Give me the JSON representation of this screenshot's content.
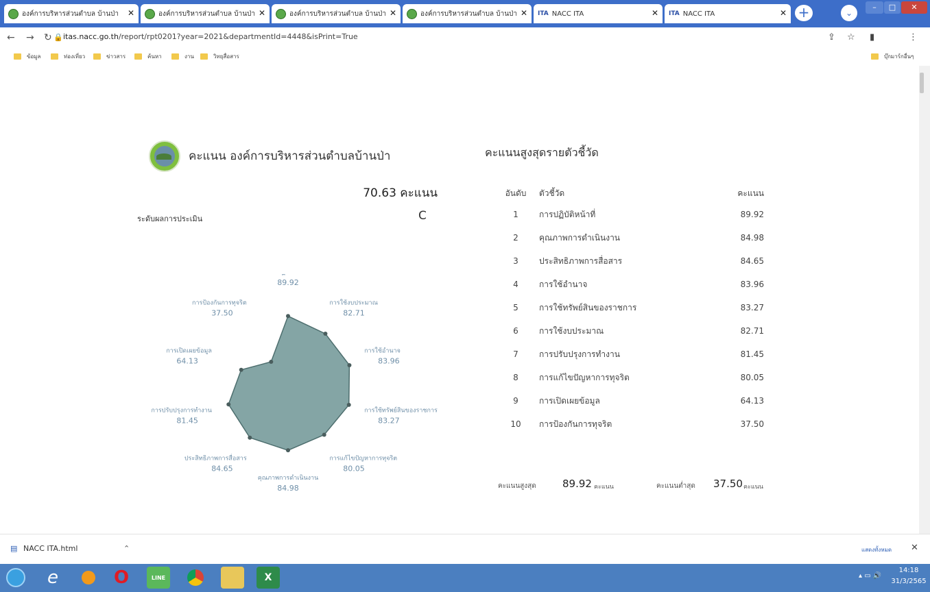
{
  "browser": {
    "tabs": [
      {
        "title": "องค์การบริหารส่วนตำบล บ้านป่า อ...",
        "icon": "sao-favicon-icon"
      },
      {
        "title": "องค์การบริหารส่วนตำบล บ้านป่า อ...",
        "icon": "sao-favicon-icon"
      },
      {
        "title": "องค์การบริหารส่วนตำบล บ้านป่า อ...",
        "icon": "sao-favicon-icon"
      },
      {
        "title": "องค์การบริหารส่วนตำบล บ้านป่า อ...",
        "icon": "sao-favicon-icon"
      },
      {
        "title": "NACC ITA",
        "icon": "ita-favicon-icon"
      },
      {
        "title": "NACC ITA",
        "icon": "ita-favicon-icon"
      }
    ],
    "ita_favicon_text": "ITA",
    "url_domain": "itas.nacc.go.th",
    "url_path": "/report/rpt0201?year=2021&departmentId=4448&isPrint=True",
    "bookmarks": [
      "ข้อมูล",
      "ท่องเที่ยว",
      "ข่าวสาร",
      "ค้นหา",
      "งาน",
      "วิทยุสื่อสาร"
    ],
    "other_bookmarks": "บุ๊กมาร์กอื่นๆ"
  },
  "report": {
    "title": "คะแนน องค์การบริหารส่วนตำบลบ้านป่า",
    "total_score": "70.63 คะแนน",
    "grade_label": "ระดับผลการประเมิน",
    "grade": "C",
    "ranking_title": "คะแนนสูงสุดรายตัวชี้วัด",
    "table_headers": {
      "rank": "อันดับ",
      "indicator": "ตัวชี้วัด",
      "score": "คะแนน"
    },
    "rows": [
      {
        "rank": "1",
        "indicator": "การปฏิบัติหน้าที่",
        "score": "89.92"
      },
      {
        "rank": "2",
        "indicator": "คุณภาพการดำเนินงาน",
        "score": "84.98"
      },
      {
        "rank": "3",
        "indicator": "ประสิทธิภาพการสื่อสาร",
        "score": "84.65"
      },
      {
        "rank": "4",
        "indicator": "การใช้อำนาจ",
        "score": "83.96"
      },
      {
        "rank": "5",
        "indicator": "การใช้ทรัพย์สินของราชการ",
        "score": "83.27"
      },
      {
        "rank": "6",
        "indicator": "การใช้งบประมาณ",
        "score": "82.71"
      },
      {
        "rank": "7",
        "indicator": "การปรับปรุงการทำงาน",
        "score": "81.45"
      },
      {
        "rank": "8",
        "indicator": "การแก้ไขปัญหาการทุจริต",
        "score": "80.05"
      },
      {
        "rank": "9",
        "indicator": "การเปิดเผยข้อมูล",
        "score": "64.13"
      },
      {
        "rank": "10",
        "indicator": "การป้องกันการทุจริต",
        "score": "37.50"
      }
    ],
    "max_label": "คะแนนสูงสุด",
    "max_value": "89.92",
    "min_label": "คะแนนต่ำสุด",
    "min_value": "37.50",
    "unit": "คะแนน"
  },
  "chart_data": {
    "type": "radar",
    "axes": [
      {
        "label": "การปฏิบัติหน้าที่",
        "value": 89.92,
        "value_text": "89.92"
      },
      {
        "label": "การใช้งบประมาณ",
        "value": 82.71,
        "value_text": "82.71"
      },
      {
        "label": "การใช้อำนาจ",
        "value": 83.96,
        "value_text": "83.96"
      },
      {
        "label": "การใช้ทรัพย์สินของราชการ",
        "value": 83.27,
        "value_text": "83.27"
      },
      {
        "label": "การแก้ไขปัญหาการทุจริต",
        "value": 80.05,
        "value_text": "80.05"
      },
      {
        "label": "คุณภาพการดำเนินงาน",
        "value": 84.98,
        "value_text": "84.98"
      },
      {
        "label": "ประสิทธิภาพการสื่อสาร",
        "value": 84.65,
        "value_text": "84.65"
      },
      {
        "label": "การปรับปรุงการทำงาน",
        "value": 81.45,
        "value_text": "81.45"
      },
      {
        "label": "การเปิดเผยข้อมูล",
        "value": 64.13,
        "value_text": "64.13"
      },
      {
        "label": "การป้องกันการทุจริต",
        "value": 37.5,
        "value_text": "37.50"
      }
    ],
    "range": [
      0,
      100
    ],
    "fill_color": "#6f9595",
    "grid": false
  },
  "downloads": {
    "file": "NACC ITA.html",
    "show_all": "แสดงทั้งหมด"
  },
  "taskbar": {
    "time": "14:18",
    "date": "31/3/2565"
  },
  "colors": {
    "tabbar": "#3d6ec9",
    "taskbar": "#4b7fc0",
    "radar_fill": "#6f9595",
    "radar_stroke": "#4d6e6e"
  }
}
